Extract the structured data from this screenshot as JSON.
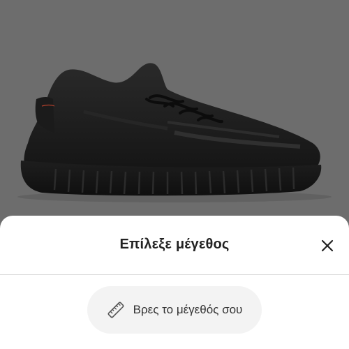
{
  "product": {
    "image_icon": "black-knit-sneaker",
    "image_background": "#6d6d6d"
  },
  "size_sheet": {
    "title": "Επίλεξε μέγεθος",
    "close_icon": "close-icon",
    "size_finder_label": "Βρες το μέγεθός σου",
    "size_finder_icon": "ruler-icon"
  }
}
